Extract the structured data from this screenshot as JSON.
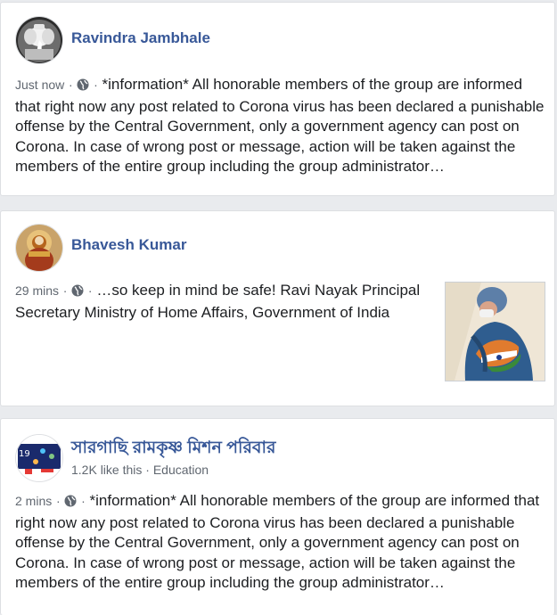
{
  "posts": [
    {
      "author": "Ravindra Jambhale",
      "time": "Just now",
      "separator": "·",
      "text": "*information* All honorable members of the group are informed that right now any post related to Corona virus has been declared a punishable offense by the Central Government, only a government agency can post on Corona. In case of wrong post or message, action will be taken against the members of the entire group including the group administrator…",
      "privacy_icon": "globe-icon"
    },
    {
      "author": "Bhavesh Kumar",
      "time": "29 mins",
      "separator": "·",
      "text": "…so keep in mind be safe! Ravi Nayak Principal Secretary Ministry of Home Affairs, Government of India",
      "privacy_icon": "globe-icon"
    },
    {
      "author": "সারগাছি রামকৃষ্ণ মিশন পরিবার",
      "likes": "1.2K like this · Education",
      "time": "2 mins",
      "separator": "·",
      "text": "*information* All honorable members of the group are informed that right now any post related to Corona virus has been declared a punishable offense by the Central Government, only a government agency can post on Corona. In case of wrong post or message, action will be taken against the members of the entire group including the group administrator…",
      "privacy_icon": "globe-icon"
    }
  ],
  "colors": {
    "author": "#385898",
    "meta": "#606770",
    "background": "#e9ebee"
  }
}
